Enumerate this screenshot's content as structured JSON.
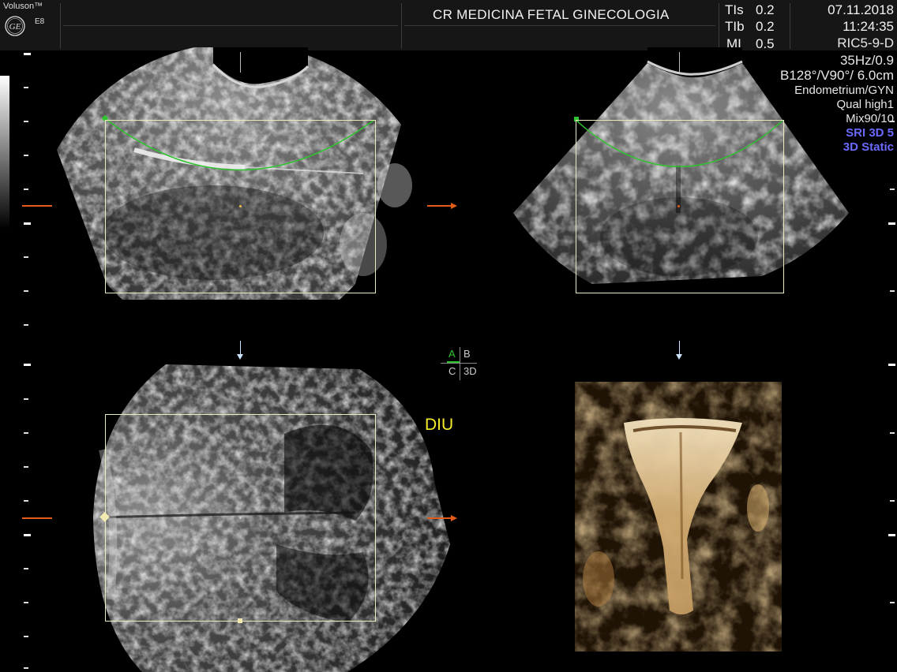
{
  "header": {
    "brand": "Voluson™",
    "model": "E8",
    "logo": "GE",
    "clinic": "CR MEDICINA FETAL GINECOLOGIA",
    "indices": [
      {
        "label": "TIs",
        "value": "0.2"
      },
      {
        "label": "TIb",
        "value": "0.2"
      },
      {
        "label": "MI",
        "value": "0.5"
      }
    ],
    "date": "07.11.2018",
    "time": "11:24:35"
  },
  "params": {
    "probe": "RIC5-9-D",
    "frequency": "35Hz/0.9",
    "angles": "B128°/V90°/ 6.0cm",
    "preset": "Endometrium/GYN",
    "quality": "Qual high1",
    "mix": "Mix90/10",
    "sri": "SRI 3D 5",
    "mode": "3D Static"
  },
  "views": {
    "quadrant": {
      "a": "A",
      "b": "B",
      "c": "C",
      "d": "3D"
    },
    "annotation": "DIU"
  },
  "colors": {
    "accent_green": "#2fc52f",
    "roi": "#ececc0",
    "ref_arrow": "#e55b1a",
    "annotation": "#f3ea2c",
    "render_warm": "#b9894a",
    "param_blue": "#6a6aff"
  }
}
